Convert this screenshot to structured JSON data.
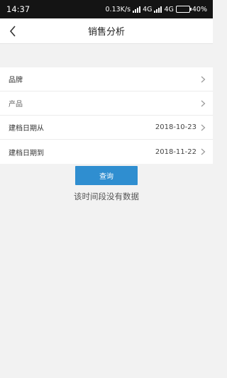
{
  "status": {
    "time": "14:37",
    "speed": "0.13K/s",
    "network1": "4G",
    "network2": "4G",
    "battery": "40%",
    "battery_level": 0.4
  },
  "nav": {
    "title": "销售分析",
    "back_icon": "chevron-left-icon"
  },
  "filters": [
    {
      "label": "品牌",
      "value": ""
    },
    {
      "label": "产品",
      "value": ""
    },
    {
      "label": "建档日期从",
      "value": "2018-10-23"
    },
    {
      "label": "建档日期到",
      "value": "2018-11-22"
    }
  ],
  "query_button": "查询",
  "empty_message": "该时间段没有数据"
}
